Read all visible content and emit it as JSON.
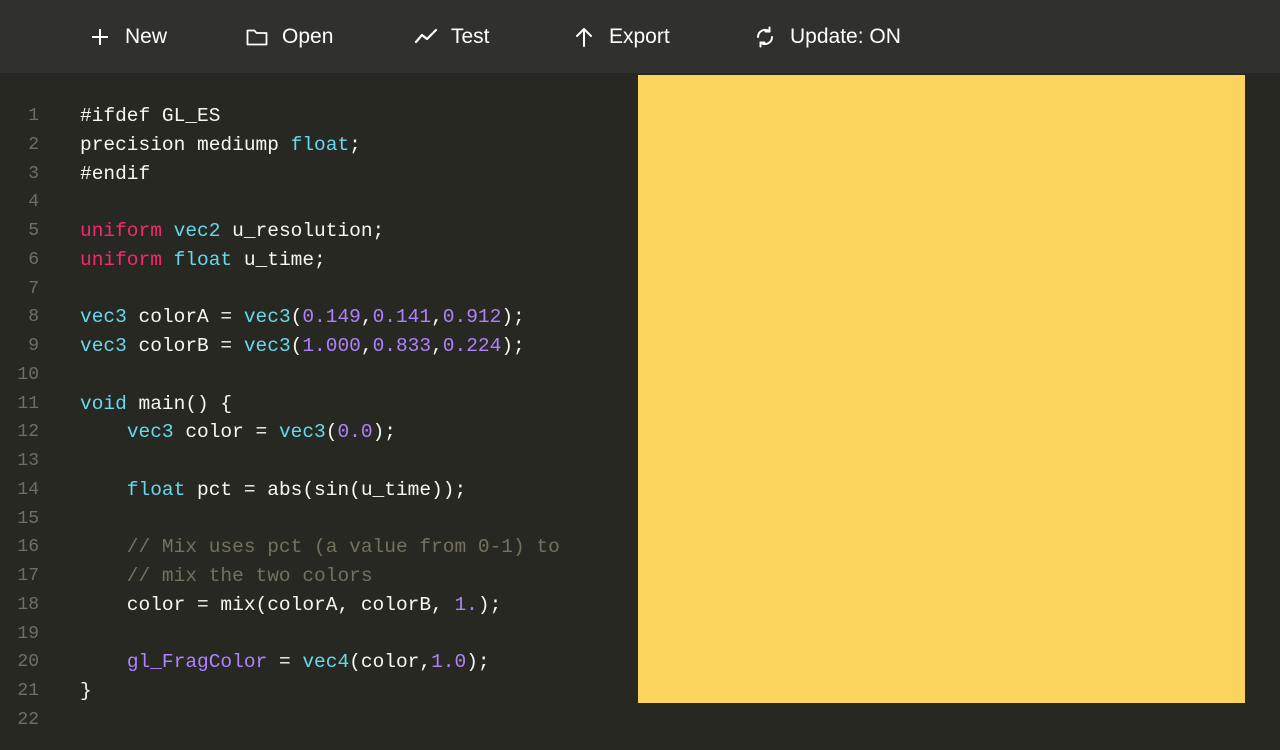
{
  "toolbar": {
    "new_label": "New",
    "open_label": "Open",
    "test_label": "Test",
    "export_label": "Export",
    "update_label": "Update: ON"
  },
  "editor": {
    "lines": [
      {
        "n": "1",
        "tokens": [
          {
            "t": "#ifdef GL_ES",
            "c": "pl"
          }
        ]
      },
      {
        "n": "2",
        "tokens": [
          {
            "t": "precision mediump ",
            "c": "pl"
          },
          {
            "t": "float",
            "c": "ty"
          },
          {
            "t": ";",
            "c": "pl"
          }
        ]
      },
      {
        "n": "3",
        "tokens": [
          {
            "t": "#endif",
            "c": "pl"
          }
        ]
      },
      {
        "n": "4",
        "tokens": []
      },
      {
        "n": "5",
        "tokens": [
          {
            "t": "uniform",
            "c": "kw"
          },
          {
            "t": " ",
            "c": "pl"
          },
          {
            "t": "vec2",
            "c": "ty"
          },
          {
            "t": " u_resolution;",
            "c": "pl"
          }
        ]
      },
      {
        "n": "6",
        "tokens": [
          {
            "t": "uniform",
            "c": "kw"
          },
          {
            "t": " ",
            "c": "pl"
          },
          {
            "t": "float",
            "c": "ty"
          },
          {
            "t": " u_time;",
            "c": "pl"
          }
        ]
      },
      {
        "n": "7",
        "tokens": []
      },
      {
        "n": "8",
        "tokens": [
          {
            "t": "vec3",
            "c": "ty"
          },
          {
            "t": " colorA = ",
            "c": "pl"
          },
          {
            "t": "vec3",
            "c": "ty"
          },
          {
            "t": "(",
            "c": "pl"
          },
          {
            "t": "0.149",
            "c": "num"
          },
          {
            "t": ",",
            "c": "pl"
          },
          {
            "t": "0.141",
            "c": "num"
          },
          {
            "t": ",",
            "c": "pl"
          },
          {
            "t": "0.912",
            "c": "num"
          },
          {
            "t": ");",
            "c": "pl"
          }
        ]
      },
      {
        "n": "9",
        "tokens": [
          {
            "t": "vec3",
            "c": "ty"
          },
          {
            "t": " colorB = ",
            "c": "pl"
          },
          {
            "t": "vec3",
            "c": "ty"
          },
          {
            "t": "(",
            "c": "pl"
          },
          {
            "t": "1.000",
            "c": "num"
          },
          {
            "t": ",",
            "c": "pl"
          },
          {
            "t": "0.833",
            "c": "num"
          },
          {
            "t": ",",
            "c": "pl"
          },
          {
            "t": "0.224",
            "c": "num"
          },
          {
            "t": ");",
            "c": "pl"
          }
        ]
      },
      {
        "n": "10",
        "tokens": []
      },
      {
        "n": "11",
        "tokens": [
          {
            "t": "void",
            "c": "ty"
          },
          {
            "t": " main() {",
            "c": "pl"
          }
        ]
      },
      {
        "n": "12",
        "tokens": [
          {
            "t": "    ",
            "c": "pl"
          },
          {
            "t": "vec3",
            "c": "ty"
          },
          {
            "t": " color = ",
            "c": "pl"
          },
          {
            "t": "vec3",
            "c": "ty"
          },
          {
            "t": "(",
            "c": "pl"
          },
          {
            "t": "0.0",
            "c": "num"
          },
          {
            "t": ");",
            "c": "pl"
          }
        ]
      },
      {
        "n": "13",
        "tokens": []
      },
      {
        "n": "14",
        "tokens": [
          {
            "t": "    ",
            "c": "pl"
          },
          {
            "t": "float",
            "c": "ty"
          },
          {
            "t": " pct = abs(sin(u_time));",
            "c": "pl"
          }
        ]
      },
      {
        "n": "15",
        "tokens": []
      },
      {
        "n": "16",
        "tokens": [
          {
            "t": "    // Mix uses pct (a value from 0-1) to",
            "c": "cm"
          }
        ]
      },
      {
        "n": "17",
        "tokens": [
          {
            "t": "    // mix the two colors",
            "c": "cm"
          }
        ]
      },
      {
        "n": "18",
        "tokens": [
          {
            "t": "    color = mix(colorA, colorB, ",
            "c": "pl"
          },
          {
            "t": "1.",
            "c": "num"
          },
          {
            "t": ");",
            "c": "pl"
          }
        ]
      },
      {
        "n": "19",
        "tokens": []
      },
      {
        "n": "20",
        "tokens": [
          {
            "t": "    ",
            "c": "pl"
          },
          {
            "t": "gl_FragColor",
            "c": "gl"
          },
          {
            "t": " = ",
            "c": "pl"
          },
          {
            "t": "vec4",
            "c": "ty"
          },
          {
            "t": "(color,",
            "c": "pl"
          },
          {
            "t": "1.0",
            "c": "num"
          },
          {
            "t": ");",
            "c": "pl"
          }
        ]
      },
      {
        "n": "21",
        "tokens": [
          {
            "t": "}",
            "c": "pl"
          }
        ]
      },
      {
        "n": "22",
        "tokens": []
      }
    ]
  },
  "preview": {
    "color": "#fad45c"
  },
  "colors": {
    "background": "#272822",
    "toolbar": "#30312c",
    "keyword": "#f92672",
    "type": "#66d9ef",
    "number": "#ae81ff",
    "comment": "#75715e"
  }
}
